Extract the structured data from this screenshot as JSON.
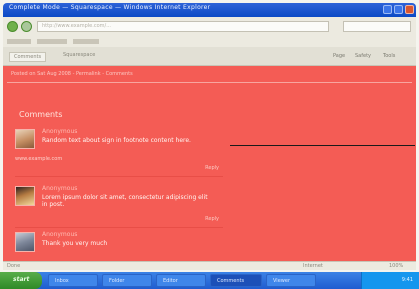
{
  "browser": {
    "window_title": "Complete Mode — Squarespace — Windows Internet Explorer",
    "address": "http://www.example.com/...",
    "tabs": [
      "Comments",
      "Squarespace"
    ],
    "toolbar": {
      "page": "Page",
      "safety": "Safety",
      "tools": "Tools"
    }
  },
  "page": {
    "top_note": "Posted on Sat Aug 2008 - Permalink - Comments",
    "comments_heading": "Comments",
    "comments": [
      {
        "author": "Anonymous",
        "body": "Random text about sign in footnote content here.",
        "sub": "www.example.com",
        "reply": "Reply"
      },
      {
        "author": "Anonymous",
        "body": "Lorem ipsum dolor sit amet, consectetur adipiscing elit in post.",
        "reply": "Reply"
      },
      {
        "author": "Anonymous",
        "body": "Thank you very much"
      }
    ]
  },
  "status": {
    "left": "Done",
    "zone": "Internet",
    "zoom": "100%"
  },
  "taskbar": {
    "start": "start",
    "tasks": [
      "Inbox",
      "Folder",
      "Editor",
      "Comments",
      "Viewer"
    ],
    "clock": "9:41"
  },
  "colors": {
    "page_bg": "#f45c55",
    "taskbar": "#1f5cd0",
    "start": "#2f8a27"
  }
}
